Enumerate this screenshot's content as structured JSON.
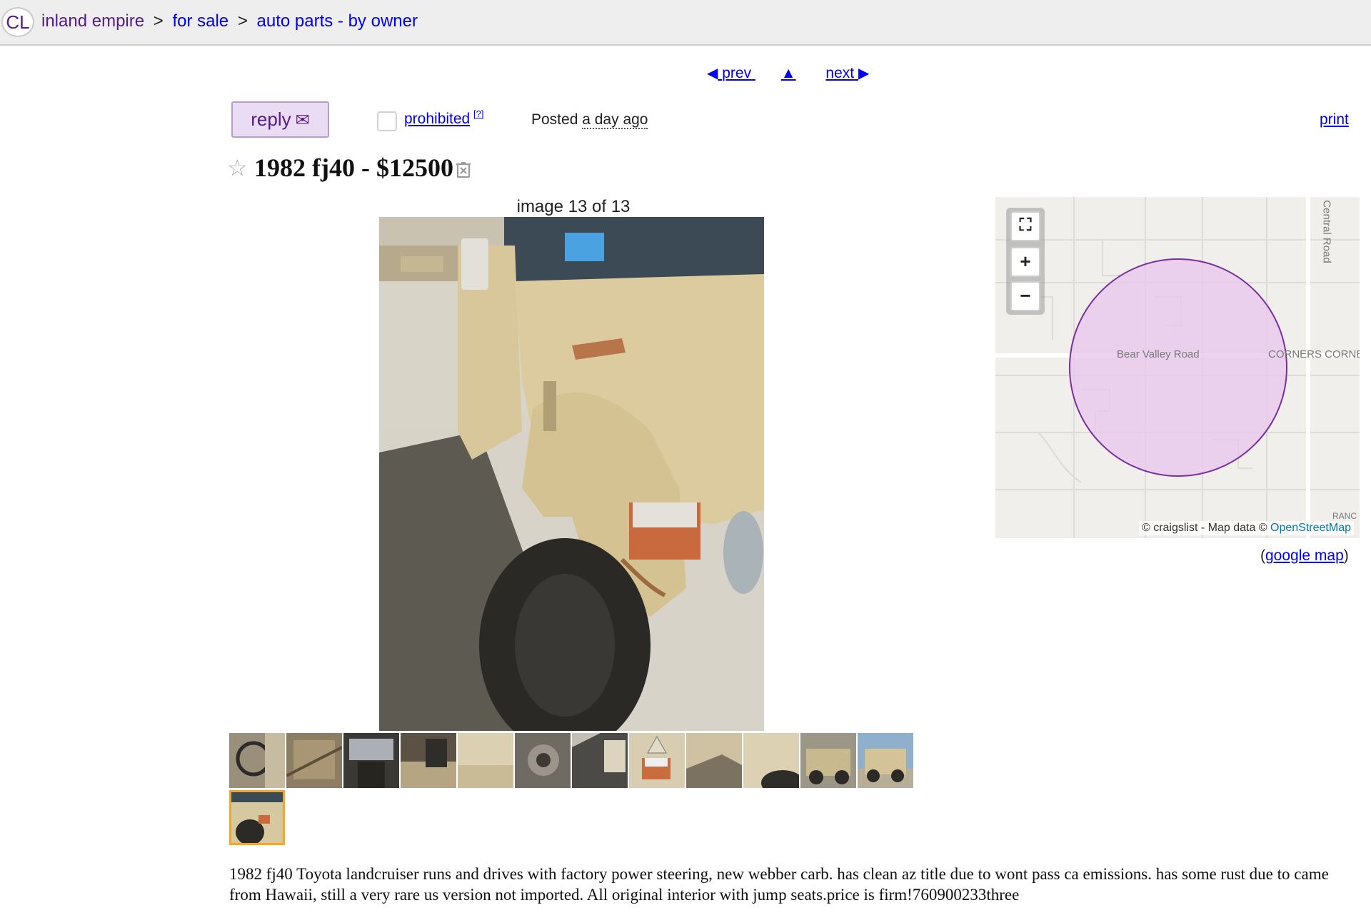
{
  "header": {
    "logo": "CL",
    "breadcrumbs": [
      {
        "label": "inland empire"
      },
      {
        "label": "for sale"
      },
      {
        "label": "auto parts - by owner"
      }
    ],
    "separator": ">"
  },
  "nav": {
    "prev": "prev",
    "up": "▲",
    "next": "next"
  },
  "actions": {
    "reply": "reply",
    "prohibited": "prohibited",
    "prohibited_help": "[?]",
    "posted_label": "Posted",
    "posted_when": "a day ago",
    "print": "print"
  },
  "posting": {
    "title": "1982 fj40 - $12500",
    "image_caption": "image 13 of 13",
    "thumbnail_count": 13,
    "selected_thumbnail": 13,
    "body": "1982 fj40 Toyota landcruiser runs and drives with factory power steering, new webber carb. has clean az title due to wont pass ca emissions. has some rust due to came from Hawaii, still a very rare us version not imported. All original interior with jump seats.price is firm!760900233three"
  },
  "map": {
    "road_labels": {
      "bear_valley": "Bear Valley Road",
      "central": "Central Road",
      "corners": "CORNERS CORNE",
      "ranc": "RANC"
    },
    "attribution_prefix": "© craigslist - Map data ©",
    "attribution_osm": "OpenStreetMap",
    "google_map": "google map",
    "controls": {
      "fullscreen": "⛶",
      "zoom_in": "+",
      "zoom_out": "−"
    }
  },
  "colors": {
    "link": "#0000ee",
    "visited": "#551a8b",
    "reply_bg": "#eadcf3",
    "map_circle_fill": "#e8c8ec",
    "map_circle_stroke": "#7a2f9e",
    "selected_thumb_border": "#f5a623"
  }
}
